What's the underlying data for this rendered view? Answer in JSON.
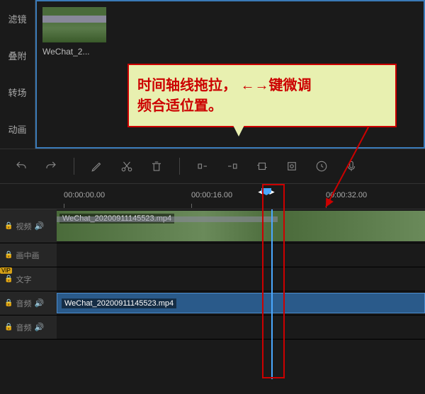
{
  "sidebar": {
    "items": [
      "滤镜",
      "叠附",
      "转场",
      "动画"
    ]
  },
  "media": {
    "thumb_label": "WeChat_2..."
  },
  "tip": {
    "line1": "时间轴线拖拉，  ←→键微调",
    "line2": "频合适位置。"
  },
  "timeline": {
    "ticks": [
      "00:00:00.00",
      "00:00:16.00",
      "00:00:32.00"
    ],
    "tracks": {
      "video": {
        "label": "视频",
        "clip": "WeChat_20200911145523.mp4"
      },
      "pip": {
        "label": "画中画"
      },
      "text": {
        "label": "文字"
      },
      "audio": {
        "label": "音频",
        "clip": "WeChat_20200911145523.mp4"
      },
      "audio2": {
        "label": "音频"
      }
    }
  },
  "icons": {
    "lock": "🔒",
    "speaker": "🔊"
  }
}
